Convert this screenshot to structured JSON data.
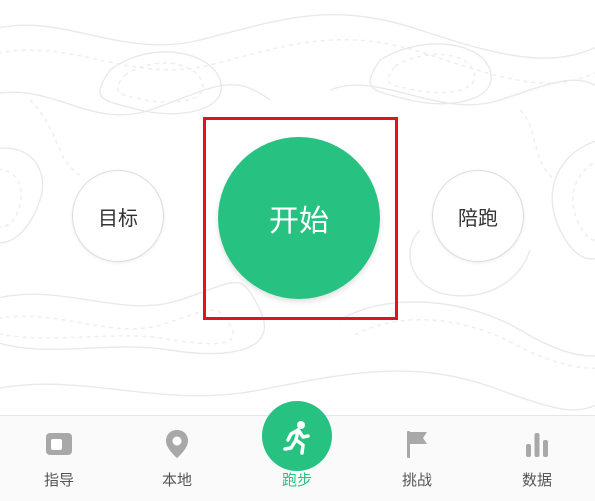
{
  "main": {
    "goal_label": "目标",
    "start_label": "开始",
    "pace_label": "陪跑"
  },
  "tabbar": {
    "items": [
      {
        "label": "指导",
        "icon": "guide-icon"
      },
      {
        "label": "本地",
        "icon": "location-pin-icon"
      },
      {
        "label": "跑步",
        "icon": "running-person-icon",
        "active": true
      },
      {
        "label": "挑战",
        "icon": "flag-icon"
      },
      {
        "label": "数据",
        "icon": "bar-chart-icon"
      }
    ]
  },
  "colors": {
    "accent": "#27c281",
    "highlight_box": "#e0141c",
    "inactive_icon": "#a8a8a8"
  }
}
